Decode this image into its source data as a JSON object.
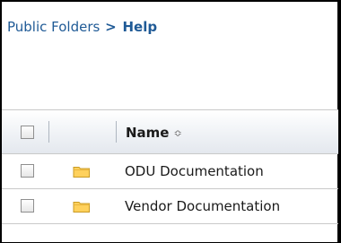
{
  "breadcrumb": {
    "parent": "Public Folders",
    "separator": ">",
    "current": "Help"
  },
  "table": {
    "columns": {
      "name": "Name",
      "sort_icon": "sort-updown-icon"
    },
    "rows": [
      {
        "name": "ODU Documentation",
        "icon": "folder-icon"
      },
      {
        "name": "Vendor Documentation",
        "icon": "folder-icon"
      }
    ]
  },
  "colors": {
    "link": "#1f5a96",
    "folder_fill": "#ffd15c",
    "folder_stroke": "#c99a22"
  }
}
